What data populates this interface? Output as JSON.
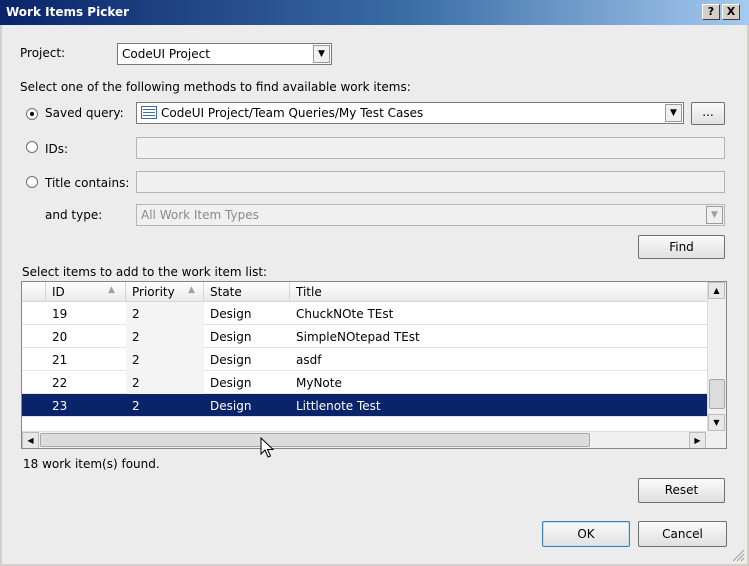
{
  "window": {
    "title": "Work Items Picker",
    "help_label": "?",
    "close_label": "X"
  },
  "project": {
    "label": "Project:",
    "value": "CodeUI Project"
  },
  "methods": {
    "instruction": "Select one of the following methods to find available work items:",
    "saved_query": {
      "label": "Saved query:",
      "value": "CodeUI Project/Team Queries/My Test Cases",
      "browse_label": "..."
    },
    "ids": {
      "label": "IDs:",
      "value": ""
    },
    "title_contains": {
      "label": "Title contains:",
      "value": ""
    },
    "type": {
      "label": "and type:",
      "value": "All Work Item Types"
    },
    "selected": "saved_query"
  },
  "find_button": "Find",
  "list": {
    "caption": "Select items to add to the work item list:",
    "columns": [
      "ID",
      "Priority",
      "State",
      "Title"
    ],
    "rows": [
      {
        "id": "19",
        "priority": "2",
        "state": "Design",
        "title": "ChuckNOte TEst"
      },
      {
        "id": "20",
        "priority": "2",
        "state": "Design",
        "title": "SimpleNOtepad TEst"
      },
      {
        "id": "21",
        "priority": "2",
        "state": "Design",
        "title": "asdf"
      },
      {
        "id": "22",
        "priority": "2",
        "state": "Design",
        "title": "MyNote"
      },
      {
        "id": "23",
        "priority": "2",
        "state": "Design",
        "title": "Littlenote Test"
      }
    ],
    "selected_row": "23"
  },
  "status_text": "18 work item(s) found.",
  "buttons": {
    "reset": "Reset",
    "ok": "OK",
    "cancel": "Cancel"
  },
  "colors": {
    "selection": "#0a246a",
    "title_bar": "#0a246a"
  }
}
